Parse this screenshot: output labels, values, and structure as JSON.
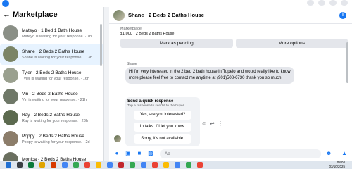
{
  "sidebar": {
    "title": "Marketplace",
    "conversations": [
      {
        "title": "Mateyo · 1 Bed 1 Bath House",
        "sub": "Mateyo is waiting for your response. · 7h",
        "thumb": "#8a8f86",
        "active": false
      },
      {
        "title": "Shane · 2 Beds 2 Baths House",
        "sub": "Shane is waiting for your response. · 13h",
        "thumb": "#7b8466",
        "active": true
      },
      {
        "title": "Tyler · 2 Beds 2 Baths House",
        "sub": "Tyler is waiting for your response. · 16h",
        "thumb": "#9aa08f",
        "active": false
      },
      {
        "title": "Vin · 2 Beds 2 Baths House",
        "sub": "Vin is waiting for your response. · 21h",
        "thumb": "#6f7868",
        "active": false
      },
      {
        "title": "Ray · 2 Beds 2 Baths House",
        "sub": "Ray is waiting for your response. · 23h",
        "thumb": "#5c6a4f",
        "active": false
      },
      {
        "title": "Poppy · 2 Beds 2 Baths House",
        "sub": "Poppy is waiting for your response. · 2d",
        "thumb": "#8c7d6a",
        "active": false
      },
      {
        "title": "Monica · 2 Beds 2 Baths House",
        "sub": "",
        "thumb": "#6a6f5f",
        "active": false
      }
    ]
  },
  "chat": {
    "title": "Shane · 2 Beds 2 Baths House",
    "listing_label": "Marketplace",
    "listing_price": "$1,000 · 2 Beds 2 Baths House",
    "mark_pending": "Mark as pending",
    "more_options": "More options",
    "sender": "Shane",
    "message": "Hi I'm very interested in the 2 bed 2 bath house in Tupelo and would really like to know more please feel free to contact me anytime at (901)508-6730 thank you so much",
    "quick_title": "Send a quick response",
    "quick_sub": "Tap a response to send it to the buyer.",
    "quick_replies": [
      "Yes, are you interested?",
      "In talks. I'll let you know.",
      "Sorry, it's not available."
    ],
    "input_placeholder": "Aa"
  },
  "taskbar": {
    "time": "08:04",
    "date": "03/10/2025"
  }
}
